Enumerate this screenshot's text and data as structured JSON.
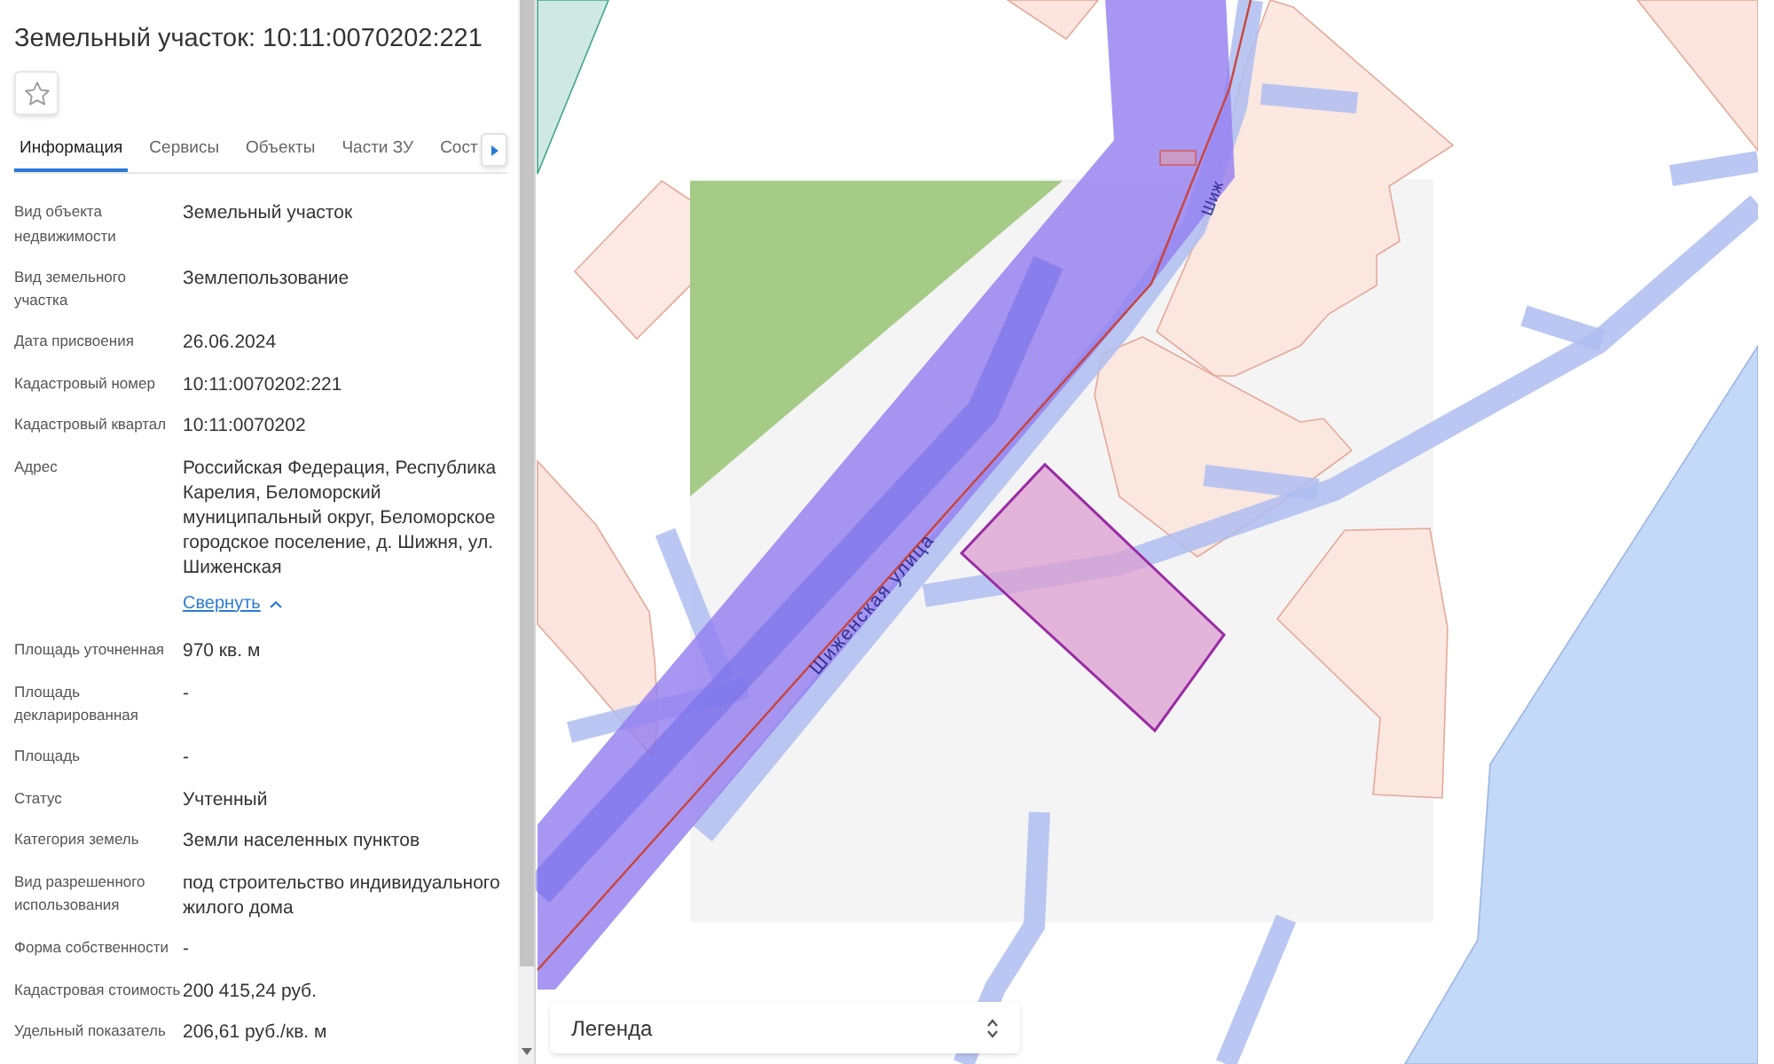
{
  "panel": {
    "title": "Земельный участок: 10:11:0070202:221",
    "tabs": [
      {
        "label": "Информация",
        "selected": true
      },
      {
        "label": "Сервисы",
        "selected": false
      },
      {
        "label": "Объекты",
        "selected": false
      },
      {
        "label": "Части ЗУ",
        "selected": false
      },
      {
        "label": "Сост",
        "selected": false
      }
    ],
    "fields": [
      {
        "label": "Вид объекта недвижимости",
        "value": "Земельный участок"
      },
      {
        "label": "Вид земельного участка",
        "value": "Землепользование"
      },
      {
        "label": "Дата присвоения",
        "value": "26.06.2024"
      },
      {
        "label": "Кадастровый номер",
        "value": "10:11:0070202:221"
      },
      {
        "label": "Кадастровый квартал",
        "value": "10:11:0070202"
      },
      {
        "label": "Адрес",
        "value": "Российская Федерация, Республика Карелия, Беломорский муниципальный округ, Беломорское городское поселение, д. Шижня, ул. Шиженская",
        "link": "Свернуть"
      },
      {
        "label": "Площадь уточненная",
        "value": "970 кв. м"
      },
      {
        "label": "Площадь декларированная",
        "value": "-"
      },
      {
        "label": "Площадь",
        "value": "-"
      },
      {
        "label": "Статус",
        "value": "Учтенный"
      },
      {
        "label": "Категория земель",
        "value": "Земли населенных пунктов"
      },
      {
        "label": "Вид разрешенного использования",
        "value": "под строительство индивидуального жилого дома"
      },
      {
        "label": "Форма собственности",
        "value": "-"
      },
      {
        "label": "Кадастровая стоимость",
        "value": "200 415,24 руб."
      },
      {
        "label": "Удельный показатель",
        "value": "206,61 руб./кв. м"
      }
    ]
  },
  "map": {
    "street_labels": [
      {
        "text": "Шиженская улица"
      },
      {
        "text": "Шиж"
      }
    ],
    "legend": {
      "label": "Легенда"
    }
  }
}
